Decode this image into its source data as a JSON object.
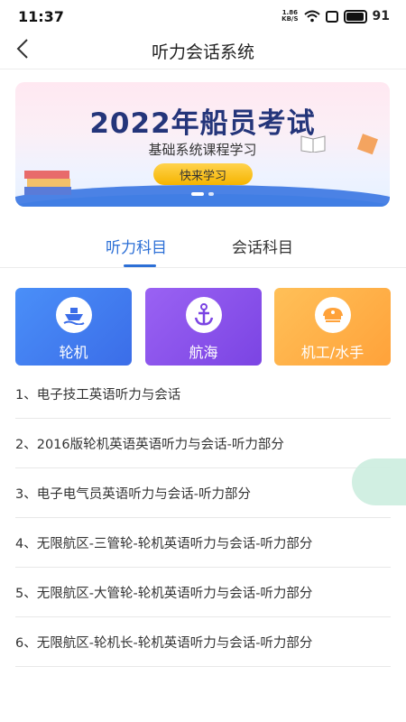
{
  "status": {
    "time": "11:37",
    "netspeed_value": "1.86",
    "netspeed_unit": "KB/S",
    "battery": "91"
  },
  "header": {
    "title": "听力会话系统"
  },
  "banner": {
    "title": "2022年船员考试",
    "subtitle": "基础系统课程学习",
    "button": "快来学习"
  },
  "tabs": [
    {
      "label": "听力科目",
      "active": true
    },
    {
      "label": "会话科目",
      "active": false
    }
  ],
  "categories": [
    {
      "label": "轮机",
      "icon": "ship-icon"
    },
    {
      "label": "航海",
      "icon": "anchor-icon"
    },
    {
      "label": "机工/水手",
      "icon": "captain-hat-icon"
    }
  ],
  "items": [
    "1、电子技工英语听力与会话",
    "2、2016版轮机英语英语听力与会话-听力部分",
    "3、电子电气员英语听力与会话-听力部分",
    "4、无限航区-三管轮-轮机英语听力与会话-听力部分",
    "5、无限航区-大管轮-轮机英语听力与会话-听力部分",
    "6、无限航区-轮机长-轮机英语听力与会话-听力部分"
  ],
  "colors": {
    "accent": "#2c6fd6"
  }
}
